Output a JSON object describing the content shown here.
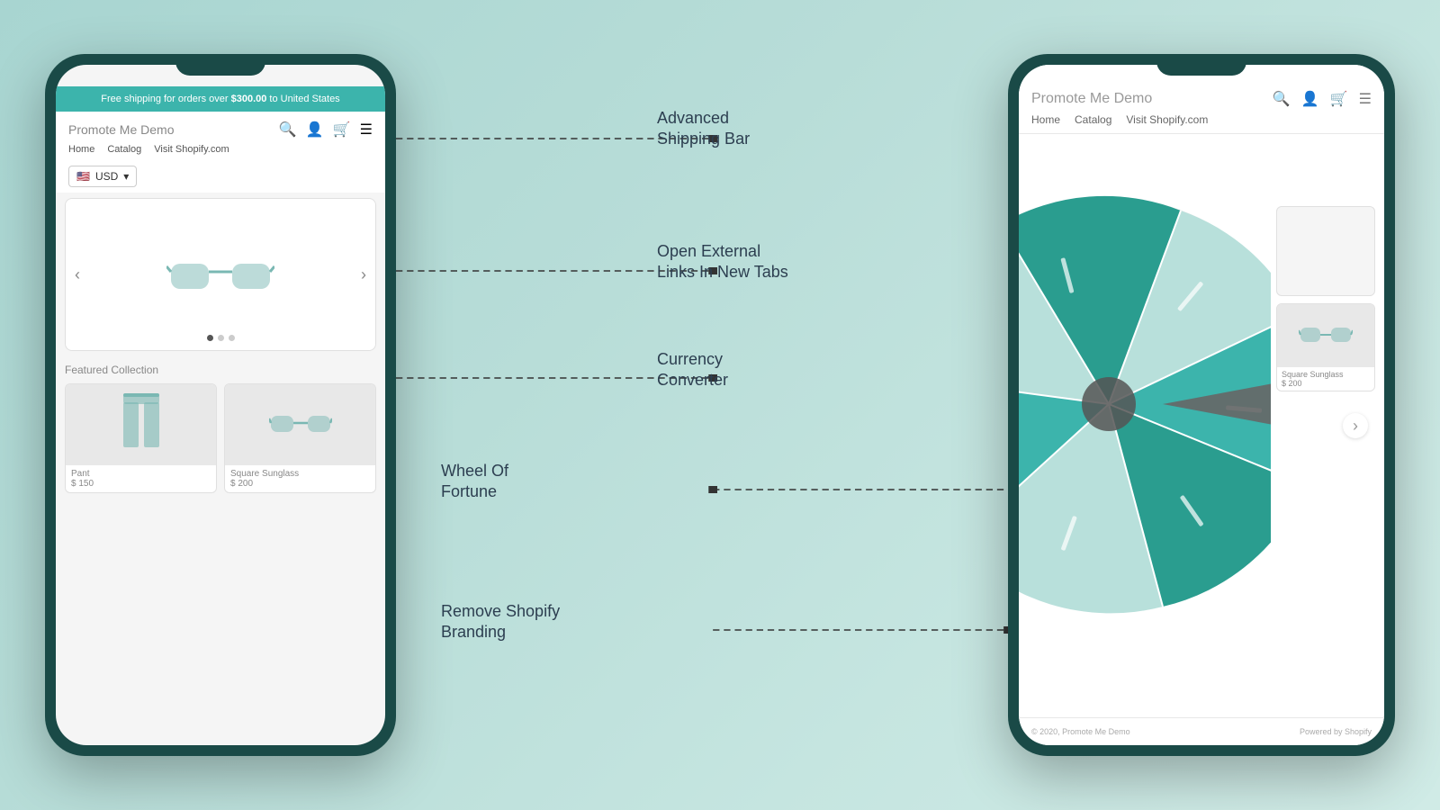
{
  "scene": {
    "background": "#b8d8d4"
  },
  "left_phone": {
    "shipping_bar": {
      "text_normal": "Free shipping for orders over ",
      "text_bold": "$300.00",
      "text_end": " to United States"
    },
    "store_name": "Promote Me Demo",
    "nav": [
      "Home",
      "Catalog",
      "Visit Shopify.com"
    ],
    "currency": "USD",
    "hero_product_alt": "sunglasses",
    "dots": [
      true,
      false,
      false
    ],
    "featured_title": "Featured Collection",
    "products": [
      {
        "name": "Pant",
        "price": "$ 150",
        "type": "pants"
      },
      {
        "name": "Square Sunglass",
        "price": "$ 200",
        "type": "sunglasses"
      }
    ]
  },
  "right_phone": {
    "store_name": "Promote Me Demo",
    "nav": [
      "Home",
      "Catalog",
      "Visit Shopify.com"
    ],
    "footer_left": "© 2020, Promote Me Demo",
    "footer_right": "Powered by Shopify",
    "side_products": [
      {
        "name": "Square Sunglass",
        "price": "$ 200"
      }
    ]
  },
  "annotations": [
    {
      "id": "shipping",
      "label": "Advanced\nShipping Bar",
      "line_y_fraction": 0.12
    },
    {
      "id": "external_links",
      "label": "Open External\nLinks In New Tabs",
      "line_y_fraction": 0.31
    },
    {
      "id": "currency",
      "label": "Currency\nConverter",
      "line_y_fraction": 0.46
    },
    {
      "id": "wheel",
      "label": "Wheel Of\nFortune",
      "line_y_fraction": 0.62
    },
    {
      "id": "branding",
      "label": "Remove Shopify\nBranding",
      "line_y_fraction": 0.82
    }
  ]
}
